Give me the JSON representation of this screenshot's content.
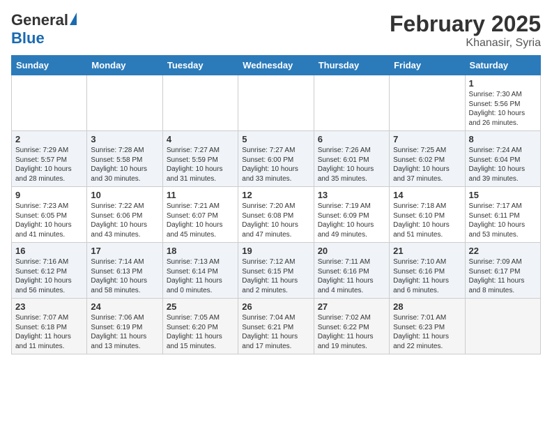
{
  "header": {
    "logo_general": "General",
    "logo_blue": "Blue",
    "month_year": "February 2025",
    "location": "Khanasir, Syria"
  },
  "weekdays": [
    "Sunday",
    "Monday",
    "Tuesday",
    "Wednesday",
    "Thursday",
    "Friday",
    "Saturday"
  ],
  "weeks": [
    [
      {
        "day": "",
        "info": ""
      },
      {
        "day": "",
        "info": ""
      },
      {
        "day": "",
        "info": ""
      },
      {
        "day": "",
        "info": ""
      },
      {
        "day": "",
        "info": ""
      },
      {
        "day": "",
        "info": ""
      },
      {
        "day": "1",
        "info": "Sunrise: 7:30 AM\nSunset: 5:56 PM\nDaylight: 10 hours and 26 minutes."
      }
    ],
    [
      {
        "day": "2",
        "info": "Sunrise: 7:29 AM\nSunset: 5:57 PM\nDaylight: 10 hours and 28 minutes."
      },
      {
        "day": "3",
        "info": "Sunrise: 7:28 AM\nSunset: 5:58 PM\nDaylight: 10 hours and 30 minutes."
      },
      {
        "day": "4",
        "info": "Sunrise: 7:27 AM\nSunset: 5:59 PM\nDaylight: 10 hours and 31 minutes."
      },
      {
        "day": "5",
        "info": "Sunrise: 7:27 AM\nSunset: 6:00 PM\nDaylight: 10 hours and 33 minutes."
      },
      {
        "day": "6",
        "info": "Sunrise: 7:26 AM\nSunset: 6:01 PM\nDaylight: 10 hours and 35 minutes."
      },
      {
        "day": "7",
        "info": "Sunrise: 7:25 AM\nSunset: 6:02 PM\nDaylight: 10 hours and 37 minutes."
      },
      {
        "day": "8",
        "info": "Sunrise: 7:24 AM\nSunset: 6:04 PM\nDaylight: 10 hours and 39 minutes."
      }
    ],
    [
      {
        "day": "9",
        "info": "Sunrise: 7:23 AM\nSunset: 6:05 PM\nDaylight: 10 hours and 41 minutes."
      },
      {
        "day": "10",
        "info": "Sunrise: 7:22 AM\nSunset: 6:06 PM\nDaylight: 10 hours and 43 minutes."
      },
      {
        "day": "11",
        "info": "Sunrise: 7:21 AM\nSunset: 6:07 PM\nDaylight: 10 hours and 45 minutes."
      },
      {
        "day": "12",
        "info": "Sunrise: 7:20 AM\nSunset: 6:08 PM\nDaylight: 10 hours and 47 minutes."
      },
      {
        "day": "13",
        "info": "Sunrise: 7:19 AM\nSunset: 6:09 PM\nDaylight: 10 hours and 49 minutes."
      },
      {
        "day": "14",
        "info": "Sunrise: 7:18 AM\nSunset: 6:10 PM\nDaylight: 10 hours and 51 minutes."
      },
      {
        "day": "15",
        "info": "Sunrise: 7:17 AM\nSunset: 6:11 PM\nDaylight: 10 hours and 53 minutes."
      }
    ],
    [
      {
        "day": "16",
        "info": "Sunrise: 7:16 AM\nSunset: 6:12 PM\nDaylight: 10 hours and 56 minutes."
      },
      {
        "day": "17",
        "info": "Sunrise: 7:14 AM\nSunset: 6:13 PM\nDaylight: 10 hours and 58 minutes."
      },
      {
        "day": "18",
        "info": "Sunrise: 7:13 AM\nSunset: 6:14 PM\nDaylight: 11 hours and 0 minutes."
      },
      {
        "day": "19",
        "info": "Sunrise: 7:12 AM\nSunset: 6:15 PM\nDaylight: 11 hours and 2 minutes."
      },
      {
        "day": "20",
        "info": "Sunrise: 7:11 AM\nSunset: 6:16 PM\nDaylight: 11 hours and 4 minutes."
      },
      {
        "day": "21",
        "info": "Sunrise: 7:10 AM\nSunset: 6:16 PM\nDaylight: 11 hours and 6 minutes."
      },
      {
        "day": "22",
        "info": "Sunrise: 7:09 AM\nSunset: 6:17 PM\nDaylight: 11 hours and 8 minutes."
      }
    ],
    [
      {
        "day": "23",
        "info": "Sunrise: 7:07 AM\nSunset: 6:18 PM\nDaylight: 11 hours and 11 minutes."
      },
      {
        "day": "24",
        "info": "Sunrise: 7:06 AM\nSunset: 6:19 PM\nDaylight: 11 hours and 13 minutes."
      },
      {
        "day": "25",
        "info": "Sunrise: 7:05 AM\nSunset: 6:20 PM\nDaylight: 11 hours and 15 minutes."
      },
      {
        "day": "26",
        "info": "Sunrise: 7:04 AM\nSunset: 6:21 PM\nDaylight: 11 hours and 17 minutes."
      },
      {
        "day": "27",
        "info": "Sunrise: 7:02 AM\nSunset: 6:22 PM\nDaylight: 11 hours and 19 minutes."
      },
      {
        "day": "28",
        "info": "Sunrise: 7:01 AM\nSunset: 6:23 PM\nDaylight: 11 hours and 22 minutes."
      },
      {
        "day": "",
        "info": ""
      }
    ]
  ]
}
